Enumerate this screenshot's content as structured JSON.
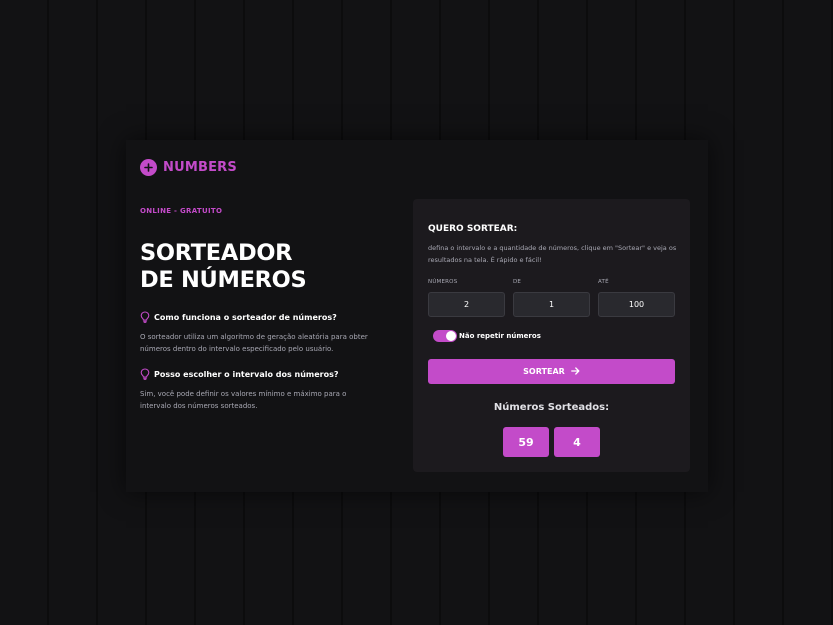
{
  "brand": {
    "name": "NUMBERS",
    "accent_color": "#c34bc9"
  },
  "hero": {
    "tagline": "ONLINE - GRATUITO",
    "title_line1": "SORTEADOR",
    "title_line2": "DE NÚMEROS"
  },
  "faq": [
    {
      "icon": "lightbulb-icon",
      "question": "Como funciona o sorteador de números?",
      "answer": "O sorteador utiliza um algoritmo de geração aleatória para obter números dentro do intervalo especificado pelo usuário."
    },
    {
      "icon": "lightbulb-icon",
      "question": "Posso escolher o intervalo dos números?",
      "answer": "Sim, você pode definir os valores mínimo e máximo para o intervalo dos números sorteados."
    }
  ],
  "form": {
    "title": "QUERO SORTEAR:",
    "description": "defina o intervalo e a quantidade de números, clique em \"Sortear\" e veja os resultados na tela. É rápido e fácil!",
    "fields": [
      {
        "label": "NÚMEROS",
        "value": "2"
      },
      {
        "label": "DE",
        "value": "1"
      },
      {
        "label": "ATÉ",
        "value": "100"
      }
    ],
    "no_repeat": {
      "label": "Não repetir números",
      "checked": true
    },
    "button_label": "SORTEAR",
    "button_icon": "arrow-right-icon"
  },
  "results": {
    "title": "Números Sorteados:",
    "numbers": [
      "59",
      "4"
    ]
  }
}
